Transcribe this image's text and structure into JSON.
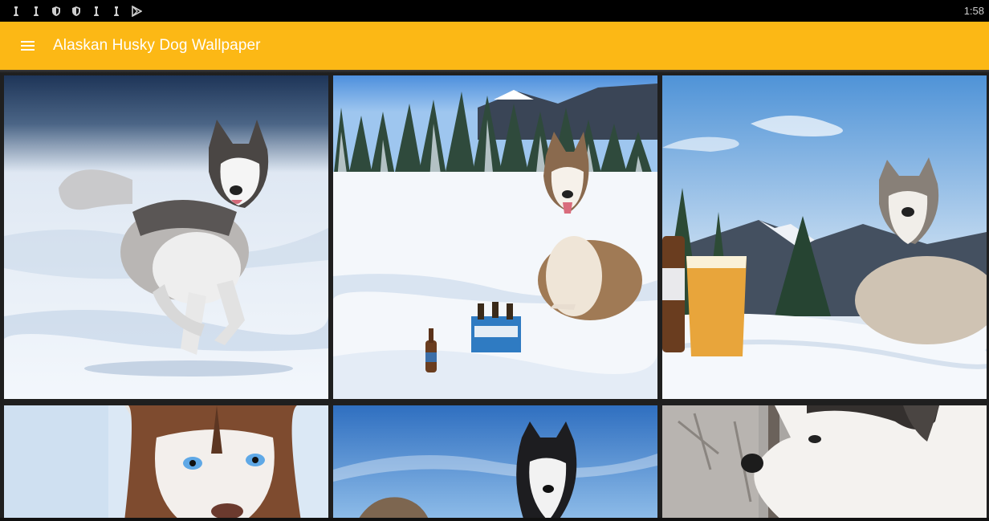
{
  "status_bar": {
    "icons": [
      "notification-icon",
      "notification-icon",
      "shield-icon",
      "shield-icon",
      "notification-icon",
      "notification-icon",
      "play-store-icon"
    ],
    "time": "1:58"
  },
  "app_bar": {
    "title": "Alaskan Husky Dog Wallpaper",
    "menu_icon": "hamburger-menu-icon",
    "color": "#FCB815"
  },
  "wallpapers": [
    {
      "subject": "husky running on snow"
    },
    {
      "subject": "husky sitting in snowy field with beer"
    },
    {
      "subject": "husky with beer glass and mountains"
    },
    {
      "subject": "brown husky face close-up"
    },
    {
      "subject": "husky against blue sky"
    },
    {
      "subject": "husky profile in forest"
    }
  ]
}
